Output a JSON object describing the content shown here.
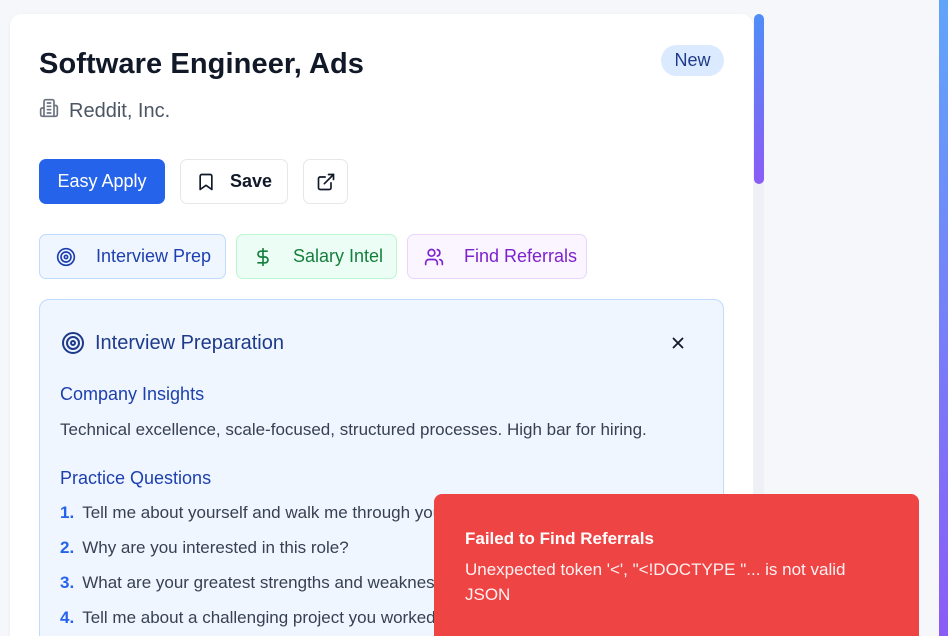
{
  "job": {
    "title": "Software Engineer, Ads",
    "company": "Reddit, Inc.",
    "badge": "New"
  },
  "actions": {
    "apply_label": "Easy Apply",
    "save_label": "Save"
  },
  "tools": [
    {
      "label": "Interview Prep",
      "icon": "target-icon"
    },
    {
      "label": "Salary Intel",
      "icon": "dollar-icon"
    },
    {
      "label": "Find Referrals",
      "icon": "users-icon"
    }
  ],
  "panel": {
    "title": "Interview Preparation",
    "insights_heading": "Company Insights",
    "insights_text": "Technical excellence, scale-focused, structured processes. High bar for hiring.",
    "questions_heading": "Practice Questions",
    "questions": [
      {
        "num": "1.",
        "text": "Tell me about yourself and walk me through your background."
      },
      {
        "num": "2.",
        "text": "Why are you interested in this role?"
      },
      {
        "num": "3.",
        "text": "What are your greatest strengths and weaknesses?"
      },
      {
        "num": "4.",
        "text": "Tell me about a challenging project you worked on."
      }
    ]
  },
  "toast": {
    "title": "Failed to Find Referrals",
    "message": "Unexpected token '<', \"<!DOCTYPE \"... is not valid JSON"
  },
  "colors": {
    "primary": "#2563eb",
    "error": "#ef4444",
    "accent_gradient_start": "#4f8df7",
    "accent_gradient_end": "#8b5cf6"
  }
}
